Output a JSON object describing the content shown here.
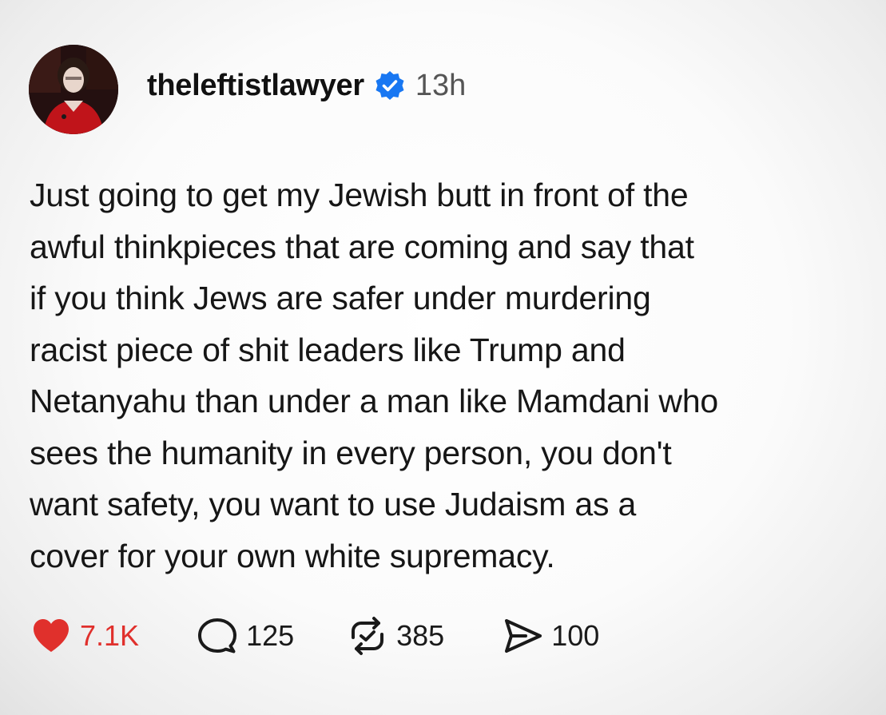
{
  "post": {
    "username": "theleftistlawyer",
    "verified_icon": "verified-badge-icon",
    "time": "13h",
    "body_lines": [
      "Just going to get my Jewish butt in front of the",
      "awful thinkpieces that are coming and say that",
      "if you think Jews are safer under murdering",
      "racist piece of shit leaders like Trump and",
      "Netanyahu than under a man like Mamdani who",
      "sees the humanity in every person, you don't",
      "want safety, you want to use Judaism as a",
      "cover for your own white supremacy."
    ]
  },
  "actions": {
    "like": {
      "icon": "heart-icon",
      "count": "7.1K",
      "active": true
    },
    "comment": {
      "icon": "comment-icon",
      "count": "125"
    },
    "repost": {
      "icon": "repost-icon",
      "count": "385"
    },
    "share": {
      "icon": "share-icon",
      "count": "100"
    }
  },
  "colors": {
    "like_red": "#e0302c",
    "verified_blue": "#1877f2",
    "text": "#111111",
    "muted": "#555555"
  }
}
